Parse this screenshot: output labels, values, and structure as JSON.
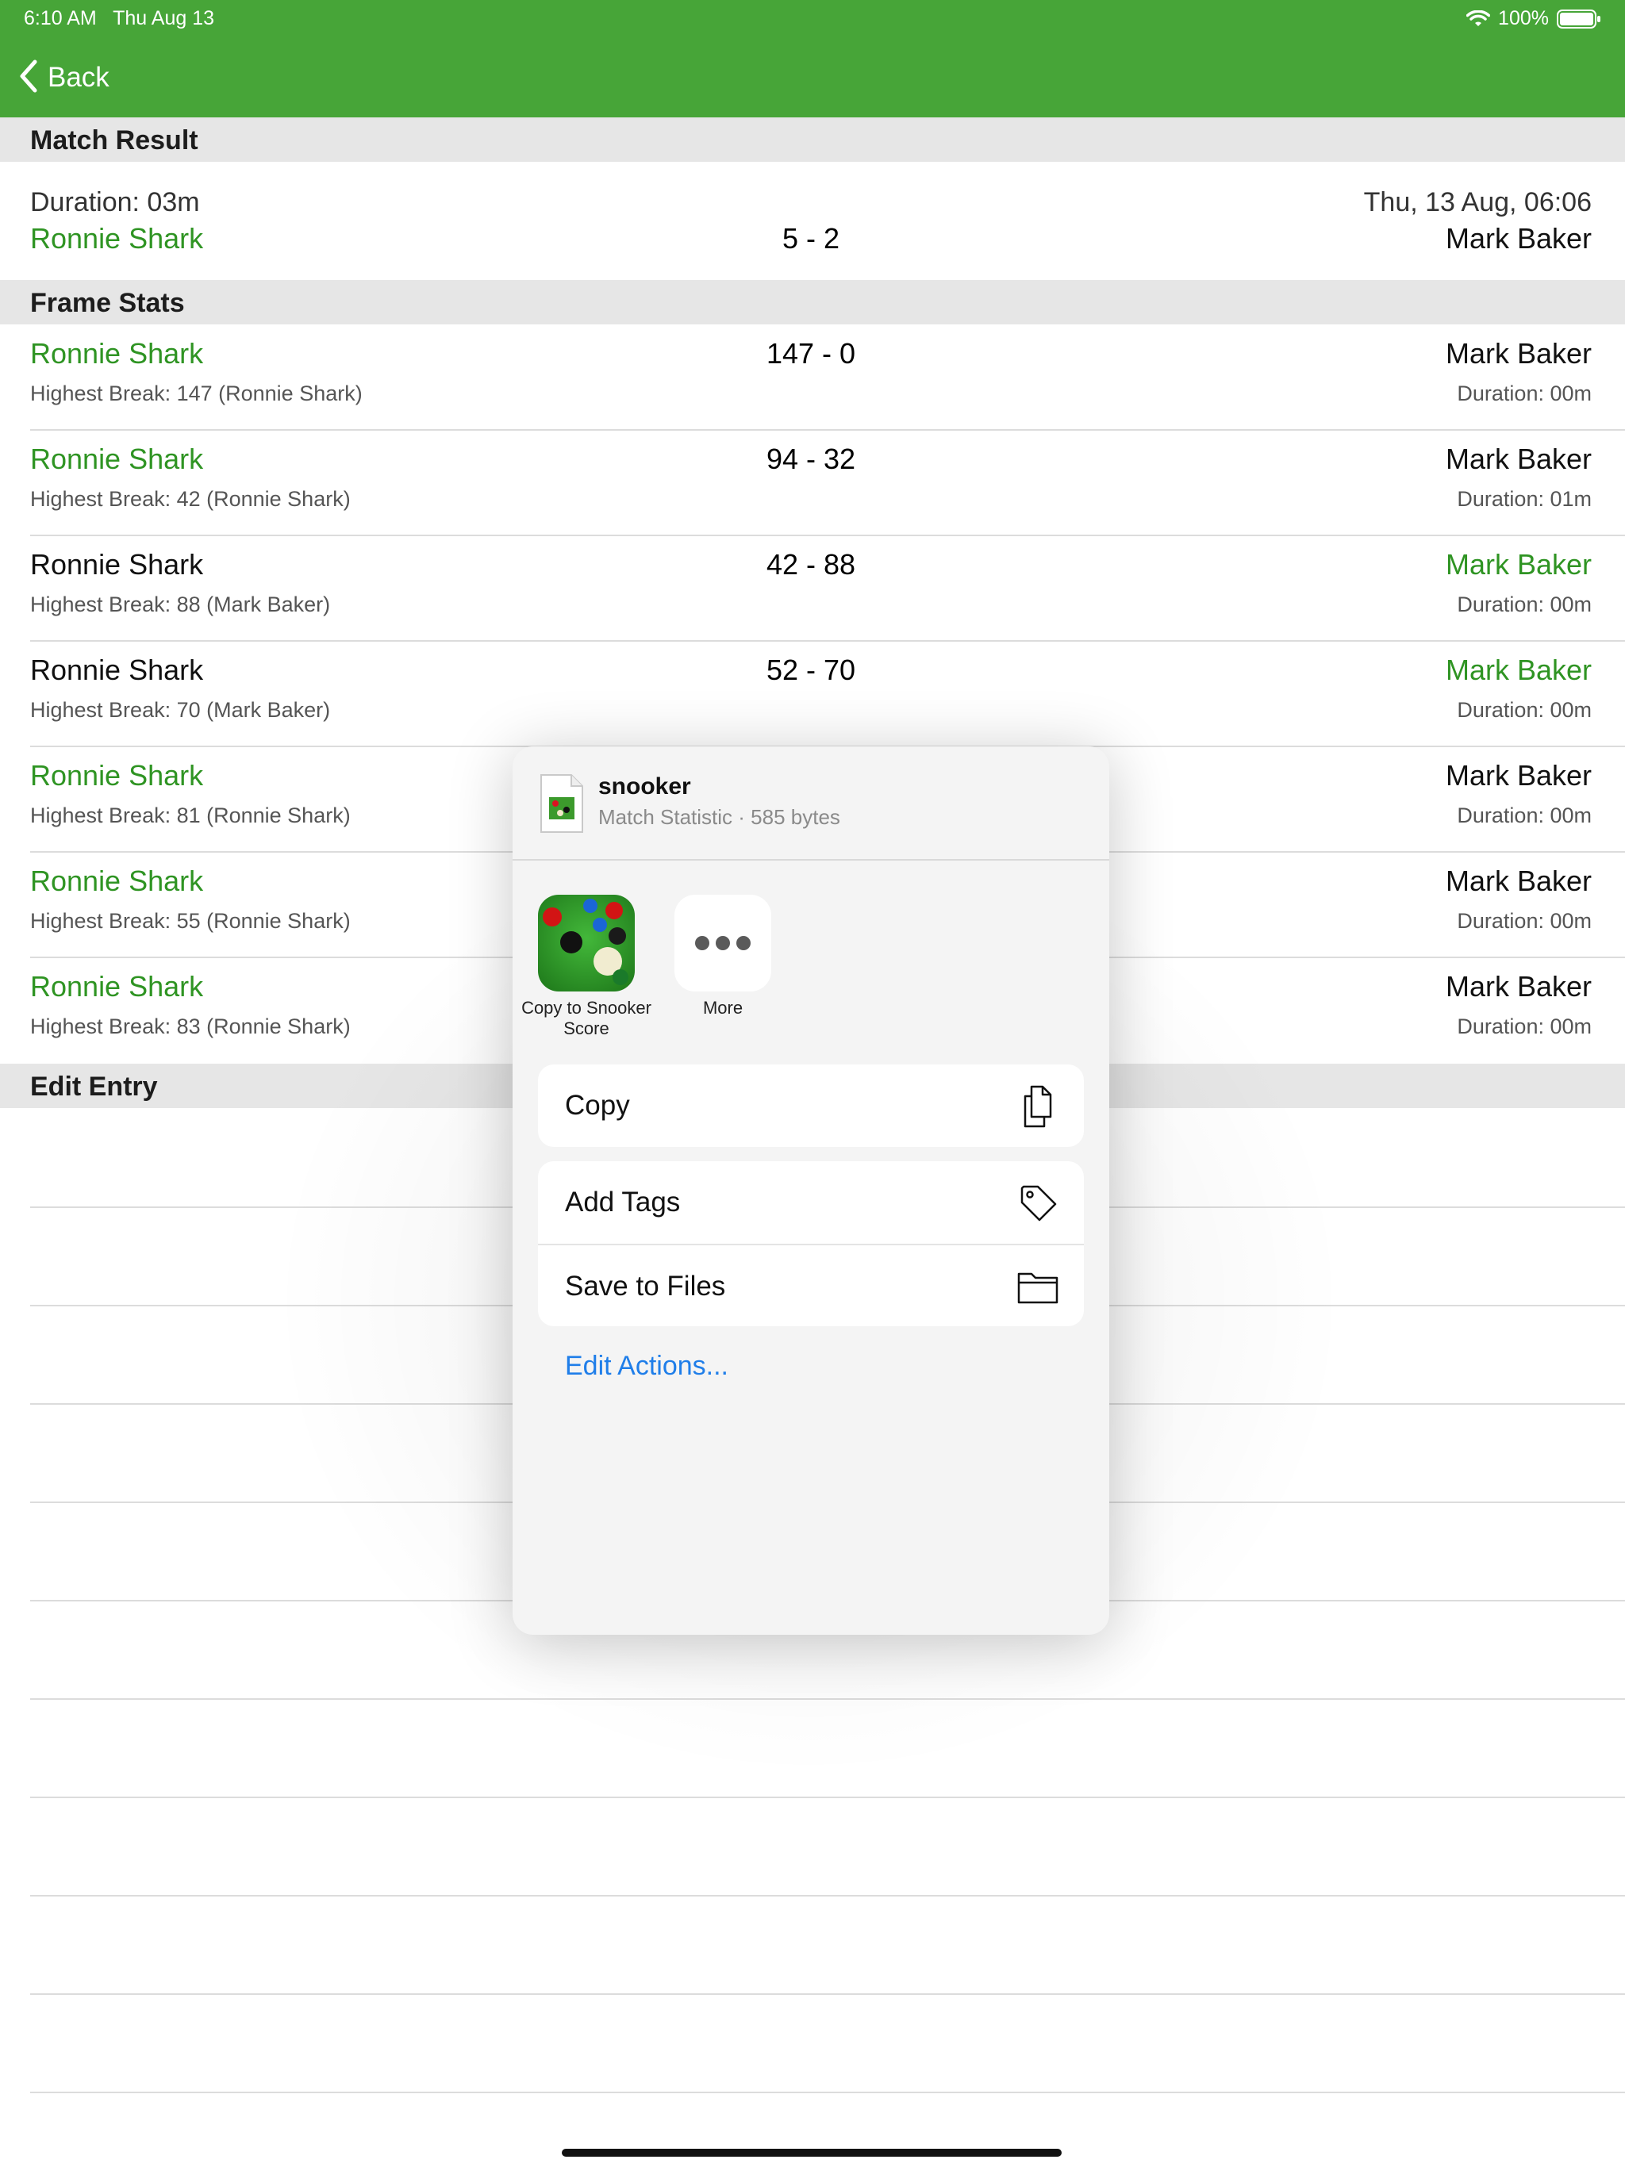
{
  "status_bar": {
    "time": "6:10 AM",
    "date": "Thu Aug 13",
    "battery": "100%"
  },
  "nav": {
    "back_label": "Back"
  },
  "sections": {
    "match_result": "Match Result",
    "frame_stats": "Frame Stats",
    "edit_entry": "Edit Entry"
  },
  "match": {
    "duration": "Duration: 03m",
    "date": "Thu, 13 Aug, 06:06",
    "player1": "Ronnie Shark",
    "player2": "Mark Baker",
    "score": "5 - 2"
  },
  "frames": [
    {
      "player1": "Ronnie Shark",
      "player2": "Mark Baker",
      "score": "147 - 0",
      "highest_break": "Highest Break: 147 (Ronnie Shark)",
      "duration": "Duration: 00m",
      "winner": "player1"
    },
    {
      "player1": "Ronnie Shark",
      "player2": "Mark Baker",
      "score": "94 - 32",
      "highest_break": "Highest Break: 42 (Ronnie Shark)",
      "duration": "Duration: 01m",
      "winner": "player1"
    },
    {
      "player1": "Ronnie Shark",
      "player2": "Mark Baker",
      "score": "42 - 88",
      "highest_break": "Highest Break: 88 (Mark Baker)",
      "duration": "Duration: 00m",
      "winner": "player2"
    },
    {
      "player1": "Ronnie Shark",
      "player2": "Mark Baker",
      "score": "52 - 70",
      "highest_break": "Highest Break: 70 (Mark Baker)",
      "duration": "Duration: 00m",
      "winner": "player2"
    },
    {
      "player1": "Ronnie Shark",
      "player2": "Mark Baker",
      "score": "",
      "highest_break": "Highest Break: 81 (Ronnie Shark)",
      "duration": "Duration: 00m",
      "winner": "player1"
    },
    {
      "player1": "Ronnie Shark",
      "player2": "Mark Baker",
      "score": "",
      "highest_break": "Highest Break: 55 (Ronnie Shark)",
      "duration": "Duration: 00m",
      "winner": "player1"
    },
    {
      "player1": "Ronnie Shark",
      "player2": "Mark Baker",
      "score": "",
      "highest_break": "Highest Break: 83 (Ronnie Shark)",
      "duration": "Duration: 00m",
      "winner": "player1"
    }
  ],
  "share_sheet": {
    "file_name": "snooker",
    "file_subtitle": "Match Statistic · 585 bytes",
    "apps": [
      {
        "label": "Copy to Snooker Score",
        "icon": "snooker-table-icon"
      },
      {
        "label": "More",
        "icon": "more-icon"
      }
    ],
    "actions": [
      {
        "label": "Copy",
        "icon": "copy-icon"
      },
      {
        "label": "Add Tags",
        "icon": "tag-icon"
      },
      {
        "label": "Save to Files",
        "icon": "folder-icon"
      }
    ],
    "edit_actions": "Edit Actions..."
  },
  "colors": {
    "header": "#47a538",
    "winner": "#2f9423",
    "link": "#1f7ee9"
  }
}
